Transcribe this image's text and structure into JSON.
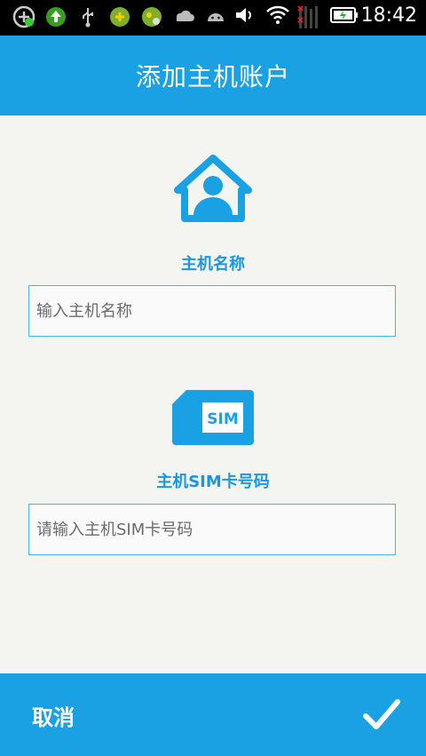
{
  "status_bar": {
    "time": "18:42",
    "icons": [
      "add-circle-icon",
      "upload-icon",
      "usb-icon",
      "app-icon",
      "app-icon-2",
      "cloud-icon",
      "android-icon",
      "volume-icon",
      "wifi-icon",
      "signal-icon",
      "battery-icon"
    ]
  },
  "header": {
    "title": "添加主机账户"
  },
  "host_name": {
    "icon": "home-user-icon",
    "label": "主机名称",
    "placeholder": "输入主机名称",
    "value": ""
  },
  "sim": {
    "icon": "sim-card-icon",
    "icon_text": "SIM",
    "label": "主机SIM卡号码",
    "placeholder": "请输入主机SIM卡号码",
    "value": ""
  },
  "footer": {
    "cancel_label": "取消",
    "confirm_icon": "checkmark-icon"
  },
  "colors": {
    "accent": "#1aa1e4",
    "label": "#1a97de",
    "background": "#f4f4f1"
  }
}
